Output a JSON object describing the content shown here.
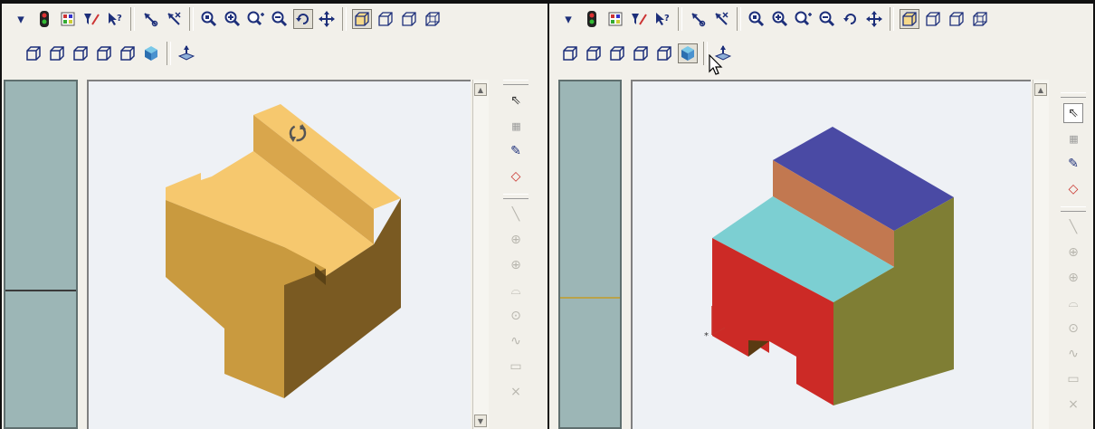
{
  "colors": {
    "ui_bg": "#f2f0ea",
    "tree_bg": "#9cb6b6",
    "viewport_bg": "#eef1f5",
    "icon_navy": "#1d2f7a",
    "wood_top": "#f6c86e",
    "wood_left": "#c99a3f",
    "wood_right": "#7a5a22",
    "face_blue": "#4a4aa4",
    "face_orange": "#c27850",
    "face_cyan": "#7ccfd2",
    "face_red": "#cc2a26",
    "face_olive": "#7f7e34"
  },
  "left_panel": {
    "toolbar_row1": [
      "dropdown-arrow",
      "traffic-light-icon",
      "color-palette-icon",
      "filter-icon",
      "whats-this-icon",
      "separator",
      "sketch-arrow-icon",
      "sketch-cross-arrow-icon",
      "separator",
      "zoom-window-icon",
      "zoom-in-icon",
      "zoom-dynamic-icon",
      "zoom-out-icon",
      "rotate-icon",
      "pan-icon",
      "separator",
      "view-front-icon",
      "view-back-icon",
      "view-side-icon",
      "view-iso-icon"
    ],
    "toolbar_row2": [
      "view-wire-1-icon",
      "view-wire-2-icon",
      "view-wire-3-icon",
      "view-wire-4-icon",
      "view-wire-5-icon",
      "shaded-cube-icon",
      "separator",
      "plane-normal-icon"
    ],
    "viewport_state": "rotate"
  },
  "right_panel": {
    "toolbar_row1": [
      "dropdown-arrow",
      "traffic-light-icon",
      "color-palette-icon",
      "filter-icon",
      "whats-this-icon",
      "separator",
      "sketch-arrow-icon",
      "sketch-cross-arrow-icon",
      "separator",
      "zoom-window-icon",
      "zoom-in-icon",
      "zoom-dynamic-icon",
      "zoom-out-icon",
      "rotate-icon",
      "pan-icon",
      "separator",
      "view-front-icon",
      "view-back-icon",
      "view-side-icon",
      "view-iso-icon"
    ],
    "toolbar_row2": [
      "view-wire-1-icon",
      "view-wire-2-icon",
      "view-wire-3-icon",
      "view-wire-4-icon",
      "view-wire-5-icon",
      "shaded-cube-icon",
      "separator",
      "plane-normal-icon"
    ],
    "viewport_state": "multicolor-shaded"
  },
  "side_tools": [
    "select-arrow-icon",
    "grid-icon",
    "sketch-pencil-icon",
    "eraser-icon",
    "line-icon",
    "circle-plus-icon",
    "arc-plus-icon",
    "arc-half-icon",
    "circle-center-icon",
    "spline-icon",
    "rectangle-icon",
    "close-x-icon",
    "dots-icon"
  ]
}
